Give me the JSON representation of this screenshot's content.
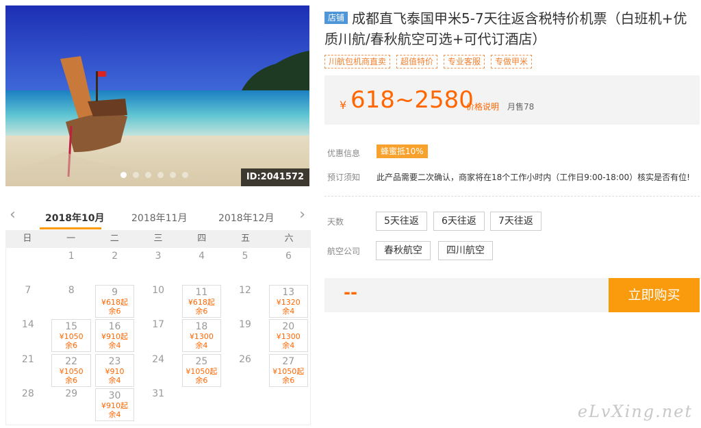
{
  "photo": {
    "id_label": "ID:2041572",
    "image_icon": "beach-longtail-boat-photo",
    "carousel_dots": 6,
    "active_dot": 0
  },
  "calendar": {
    "prev_icon": "chevron-left-icon",
    "next_icon": "chevron-right-icon",
    "prev_glyph": "‹",
    "next_glyph": "›",
    "months": [
      "2018年10月",
      "2018年11月",
      "2018年12月"
    ],
    "active_month": 0,
    "weekdays": [
      "日",
      "一",
      "二",
      "三",
      "四",
      "五",
      "六"
    ],
    "weeks": [
      [
        {
          "d": ""
        },
        {
          "d": "1"
        },
        {
          "d": "2"
        },
        {
          "d": "3"
        },
        {
          "d": "4"
        },
        {
          "d": "5"
        },
        {
          "d": "6"
        }
      ],
      [
        {
          "d": "7"
        },
        {
          "d": "8"
        },
        {
          "d": "9",
          "price": "¥618起",
          "rem": "余6"
        },
        {
          "d": "10"
        },
        {
          "d": "11",
          "price": "¥618起",
          "rem": "余6"
        },
        {
          "d": "12"
        },
        {
          "d": "13",
          "price": "¥1320",
          "rem": "余4"
        }
      ],
      [
        {
          "d": "14"
        },
        {
          "d": "15",
          "price": "¥1050",
          "rem": "余6"
        },
        {
          "d": "16",
          "price": "¥910起",
          "rem": "余4"
        },
        {
          "d": "17"
        },
        {
          "d": "18",
          "price": "¥1300",
          "rem": "余4"
        },
        {
          "d": "19"
        },
        {
          "d": "20",
          "price": "¥1300",
          "rem": "余4"
        }
      ],
      [
        {
          "d": "21"
        },
        {
          "d": "22",
          "price": "¥1050",
          "rem": "余6"
        },
        {
          "d": "23",
          "price": "¥910",
          "rem": "余4"
        },
        {
          "d": "24"
        },
        {
          "d": "25",
          "price": "¥1050起",
          "rem": "余6"
        },
        {
          "d": "26"
        },
        {
          "d": "27",
          "price": "¥1050起",
          "rem": "余6"
        }
      ],
      [
        {
          "d": "28"
        },
        {
          "d": "29"
        },
        {
          "d": "30",
          "price": "¥910起",
          "rem": "余4"
        },
        {
          "d": "31"
        },
        {
          "d": ""
        },
        {
          "d": ""
        },
        {
          "d": ""
        }
      ]
    ]
  },
  "product": {
    "shop_tag": "店铺",
    "title": "成都直飞泰国甲米5-7天往返含税特价机票（白班机+优质川航/春秋航空可选+可代订酒店）",
    "tags": [
      "川航包机商直卖",
      "超值特价",
      "专业客服",
      "专做甲米"
    ],
    "price_currency": "¥",
    "price_range": "618~2580",
    "price_note": "价格说明",
    "monthly_sales": "月售78"
  },
  "info": {
    "promo_label": "优惠信息",
    "promo_badge": "蜂蜜抵10%",
    "notice_label": "预订须知",
    "notice_text": "此产品需要二次确认，商家将在18个工作小时内（工作日9:00-18:00）核实是否有位!"
  },
  "options": {
    "days_label": "天数",
    "days": [
      "5天往返",
      "6天往返",
      "7天往返"
    ],
    "airline_label": "航空公司",
    "airlines": [
      "春秋航空",
      "四川航空"
    ]
  },
  "buy": {
    "price_placeholder": "--",
    "button": "立即购买"
  },
  "watermark": "eLvXing.net",
  "colors": {
    "accent": "#ff6600",
    "buy_button": "#f99b0c",
    "shop_tag": "#4e96d7",
    "badge": "#f8a12c"
  }
}
